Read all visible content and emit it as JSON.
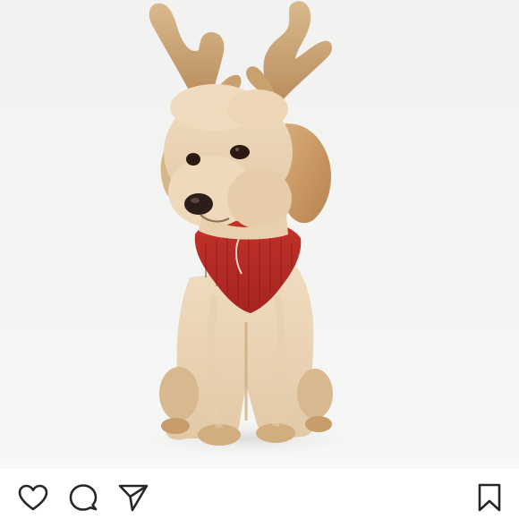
{
  "post": {
    "image": {
      "subject": "poodle-mix-dog-with-reindeer-antlers-and-red-sweater",
      "background_color": "#f3f3f2",
      "sweater_color": "#b32a25",
      "fur_color": "#e8d2b4",
      "antler_color": "#c9a47a"
    },
    "actions": {
      "like_icon": "heart-icon",
      "comment_icon": "speech-bubble-icon",
      "share_icon": "paper-plane-icon",
      "save_icon": "bookmark-icon",
      "icon_color": "#262626"
    }
  }
}
